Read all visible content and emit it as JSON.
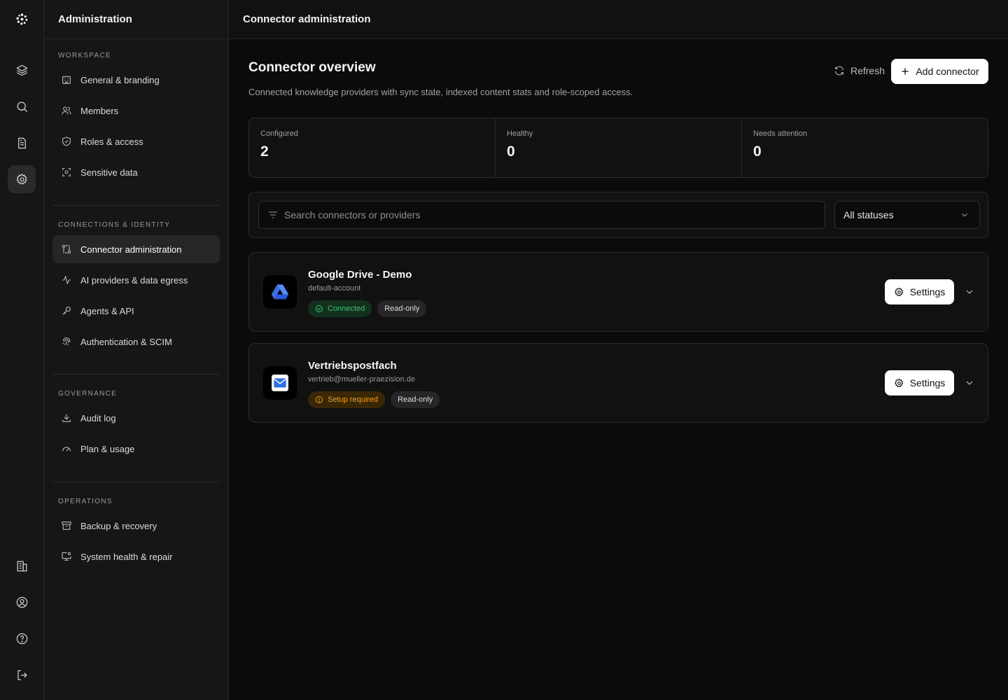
{
  "sidebar": {
    "title": "Administration",
    "sections": [
      {
        "title": "WORKSPACE",
        "items": [
          "General & branding",
          "Members",
          "Roles & access",
          "Sensitive data"
        ]
      },
      {
        "title": "CONNECTIONS & IDENTITY",
        "items": [
          "Connector administration",
          "AI providers & data egress",
          "Agents & API",
          "Authentication & SCIM"
        ]
      },
      {
        "title": "GOVERNANCE",
        "items": [
          "Audit log",
          "Plan & usage"
        ]
      },
      {
        "title": "OPERATIONS",
        "items": [
          "Backup & recovery",
          "System health & repair"
        ]
      }
    ]
  },
  "topbar": {
    "title": "Connector administration"
  },
  "main": {
    "title": "Connector overview",
    "subtitle": "Connected knowledge providers with sync state, indexed content stats and role-scoped access.",
    "refresh_label": "Refresh",
    "add_label": "Add connector",
    "stats": [
      {
        "label": "Configured",
        "value": "2"
      },
      {
        "label": "Healthy",
        "value": "0"
      },
      {
        "label": "Needs attention",
        "value": "0"
      }
    ],
    "search_placeholder": "Search connectors or providers",
    "status_filter": "All statuses",
    "connectors": [
      {
        "name": "Google Drive - Demo",
        "account": "default-account",
        "status": "Connected",
        "access": "Read-only",
        "settings_label": "Settings"
      },
      {
        "name": "Vertriebspostfach",
        "account": "vertrieb@mueller-praezision.de",
        "status": "Setup required",
        "access": "Read-only",
        "settings_label": "Settings"
      }
    ]
  },
  "colors": {
    "accent_connected": "#3fbf6f",
    "accent_warning": "#f0a020",
    "drive_blue": "#4a7cf0",
    "mail_blue": "#2f6fe4"
  }
}
